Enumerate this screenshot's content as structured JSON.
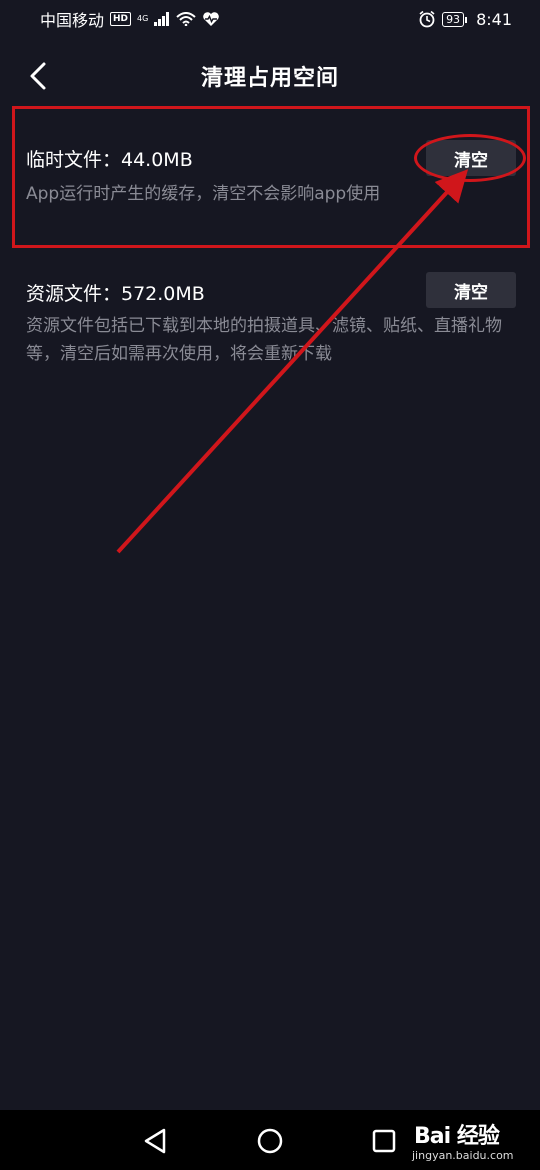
{
  "status_bar": {
    "carrier": "中国移动",
    "hd": "HD",
    "network": "4G",
    "battery": "93",
    "time": "8:41"
  },
  "header": {
    "title": "清理占用空间"
  },
  "items": [
    {
      "title": "临时文件：44.0MB",
      "desc": "App运行时产生的缓存，清空不会影响app使用",
      "button": "清空"
    },
    {
      "title": "资源文件：572.0MB",
      "desc": "资源文件包括已下载到本地的拍摄道具、滤镜、贴纸、直播礼物等，清空后如需再次使用，将会重新下载",
      "button": "清空"
    }
  ],
  "watermark": {
    "logo": "Bai 经验",
    "site": "jingyan.baidu.com"
  },
  "colors": {
    "background": "#161722",
    "button_bg": "#2f303b",
    "desc_text": "#8a8b95",
    "annotation": "#d0161b"
  }
}
